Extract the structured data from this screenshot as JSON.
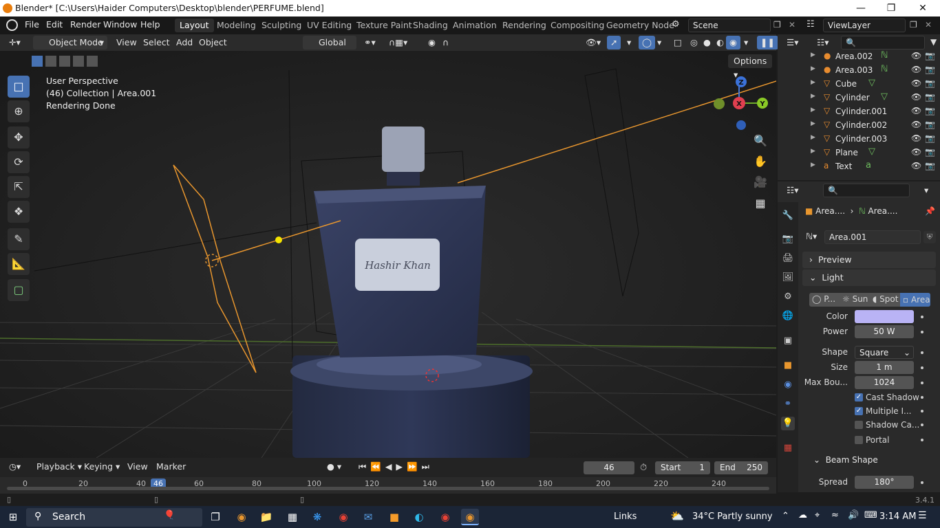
{
  "window": {
    "title": "Blender* [C:\\Users\\Haider Computers\\Desktop\\blender\\PERFUME.blend]"
  },
  "menus": [
    "File",
    "Edit",
    "Render",
    "Window",
    "Help"
  ],
  "workspaces": [
    "Layout",
    "Modeling",
    "Sculpting",
    "UV Editing",
    "Texture Paint",
    "Shading",
    "Animation",
    "Rendering",
    "Compositing",
    "Geometry Node"
  ],
  "scene": "Scene",
  "view_layer": "ViewLayer",
  "viewport": {
    "mode": "Object Mode",
    "menus": [
      "View",
      "Select",
      "Add",
      "Object"
    ],
    "orientation": "Global",
    "options": "Options",
    "overlay_lines": [
      "User Perspective",
      "(46) Collection | Area.001",
      "Rendering Done"
    ],
    "label_text": "Hashir Khan",
    "gizmo": {
      "x": "X",
      "y": "Y",
      "z": "Z"
    }
  },
  "outliner": {
    "items": [
      {
        "name": "Area.002",
        "icon": "light-icon"
      },
      {
        "name": "Area.003",
        "icon": "light-icon"
      },
      {
        "name": "Cube",
        "icon": "mesh-icon"
      },
      {
        "name": "Cylinder",
        "icon": "mesh-icon"
      },
      {
        "name": "Cylinder.001",
        "icon": "mesh-icon"
      },
      {
        "name": "Cylinder.002",
        "icon": "mesh-icon"
      },
      {
        "name": "Cylinder.003",
        "icon": "mesh-icon"
      },
      {
        "name": "Plane",
        "icon": "mesh-icon"
      },
      {
        "name": "Text",
        "icon": "text-icon"
      }
    ]
  },
  "properties": {
    "breadcrumb": [
      "Area....",
      "Area...."
    ],
    "datablock": "Area.001",
    "sections": {
      "preview": "Preview",
      "light": "Light",
      "beam": "Beam Shape"
    },
    "light_types": [
      "P...",
      "Sun",
      "Spot",
      "Area"
    ],
    "color_label": "Color",
    "color_value": "#b9b3f5",
    "power_label": "Power",
    "power": "50 W",
    "shape_label": "Shape",
    "shape": "Square",
    "size_label": "Size",
    "size": "1 m",
    "maxbounce_label": "Max Bou...",
    "maxbounce": "1024",
    "checks": [
      {
        "label": "Cast Shadow",
        "on": true
      },
      {
        "label": "Multiple I...",
        "on": true
      },
      {
        "label": "Shadow Ca...",
        "on": false
      },
      {
        "label": "Portal",
        "on": false
      }
    ],
    "spread_label": "Spread",
    "spread": "180°"
  },
  "timeline": {
    "menus": [
      "Playback",
      "Keying",
      "View",
      "Marker"
    ],
    "current_frame": "46",
    "start_label": "Start",
    "start": "1",
    "end_label": "End",
    "end": "250",
    "ruler": [
      "0",
      "20",
      "40",
      "46",
      "60",
      "80",
      "100",
      "120",
      "140",
      "160",
      "180",
      "200",
      "220",
      "240"
    ]
  },
  "version": "3.4.1",
  "taskbar": {
    "search": "Search",
    "links": "Links",
    "weather": "34°C  Partly sunny",
    "time": "3:14 AM"
  }
}
